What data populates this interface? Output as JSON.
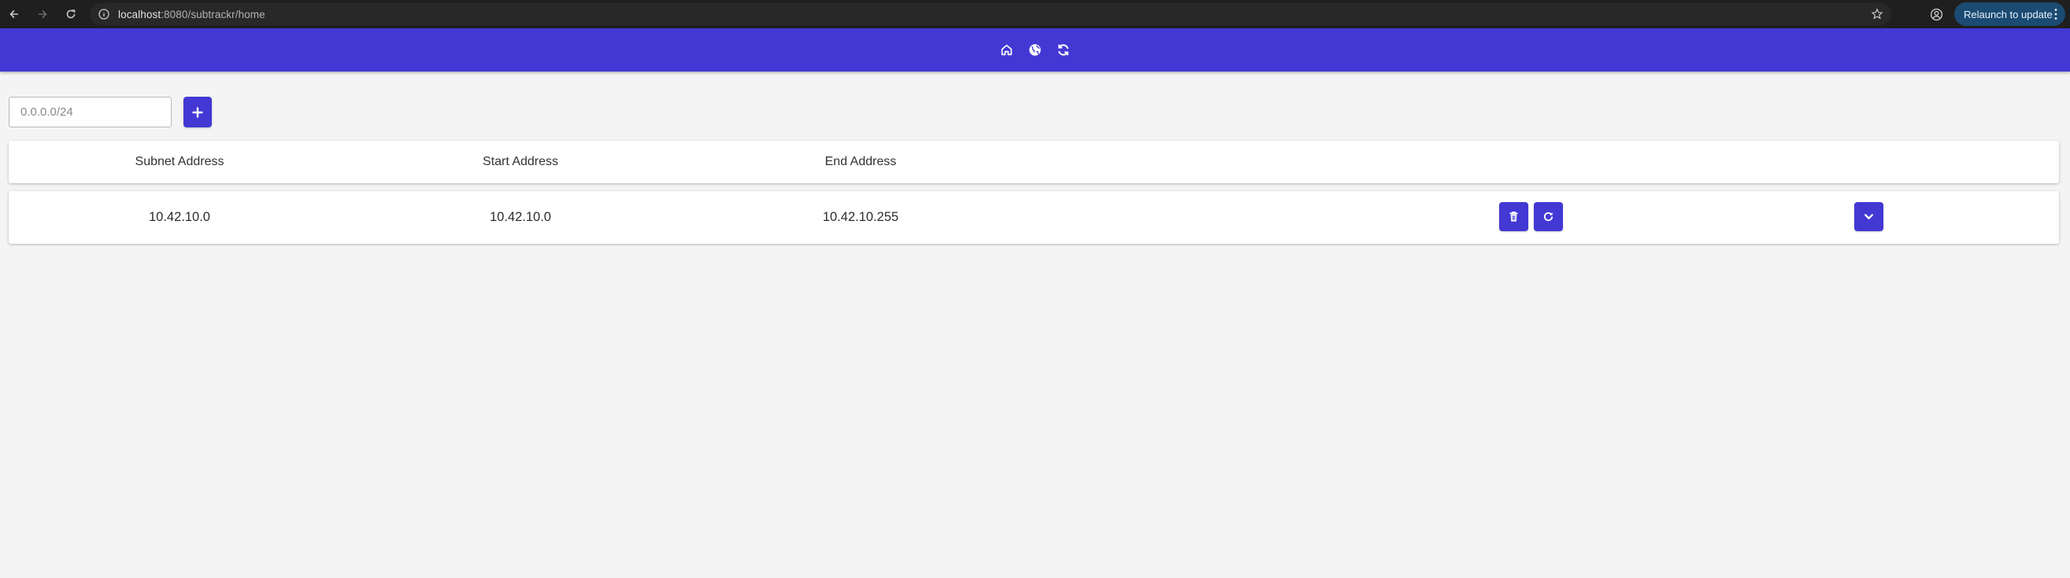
{
  "browser": {
    "url_host": "localhost",
    "url_rest": ":8080/subtrackr/home",
    "relaunch_label": "Relaunch to update"
  },
  "appbar": {
    "icons": [
      "home-icon",
      "globe-icon",
      "sync-icon"
    ]
  },
  "add_form": {
    "input_placeholder": "0.0.0.0/24",
    "input_value": "",
    "add_button_icon": "plus-icon"
  },
  "table": {
    "headers": [
      "Subnet Address",
      "Start Address",
      "End Address"
    ],
    "rows": [
      {
        "subnet": "10.42.10.0",
        "start": "10.42.10.0",
        "end": "10.42.10.255",
        "actions": [
          "trash-icon",
          "refresh-icon",
          "chevron-down-icon"
        ]
      }
    ]
  },
  "colors": {
    "accent": "#4338d4",
    "background": "#f4f4f4",
    "chrome": "#1f1f1f"
  }
}
